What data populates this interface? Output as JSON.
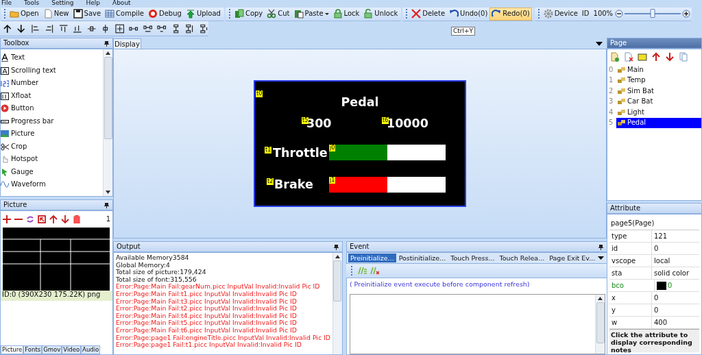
{
  "menu": [
    "File",
    "Tools",
    "Setting",
    "Help",
    "About"
  ],
  "toolbar": {
    "groups": [
      [
        {
          "label": "Open",
          "dropdown": false,
          "highlighted": false
        },
        {
          "label": "New",
          "dropdown": false,
          "highlighted": false
        },
        {
          "label": "Save",
          "dropdown": false,
          "highlighted": false
        },
        {
          "label": "Compile",
          "dropdown": false,
          "highlighted": false
        },
        {
          "label": "Debug",
          "dropdown": false,
          "highlighted": false
        },
        {
          "label": "Upload",
          "dropdown": false,
          "highlighted": false
        }
      ],
      [
        {
          "label": "Copy",
          "dropdown": false,
          "highlighted": false
        },
        {
          "label": "Cut",
          "dropdown": false,
          "highlighted": false
        },
        {
          "label": "Paste",
          "dropdown": true,
          "highlighted": false
        },
        {
          "label": "Lock",
          "dropdown": false,
          "highlighted": false
        },
        {
          "label": "Unlock",
          "dropdown": false,
          "highlighted": false
        }
      ],
      [
        {
          "label": "Delete",
          "dropdown": false,
          "highlighted": false
        },
        {
          "label": "Undo(0)",
          "dropdown": false,
          "highlighted": false
        },
        {
          "label": "Redo(0)",
          "dropdown": false,
          "highlighted": true
        }
      ],
      [
        {
          "label": "Device",
          "dropdown": false,
          "highlighted": false
        },
        {
          "label": "ID",
          "dropdown": false,
          "highlighted": false
        },
        {
          "label": "100%",
          "dropdown": false,
          "highlighted": false
        }
      ]
    ],
    "zoom_slider": {
      "level": 0.5
    },
    "tooltip": "Ctrl+Y"
  },
  "toolbox": {
    "title": "Toolbox",
    "items": [
      "Text",
      "Scrolling text",
      "Number",
      "Xfloat",
      "Button",
      "Progress bar",
      "Picture",
      "Crop",
      "Hotspot",
      "Gauge",
      "Waveform"
    ]
  },
  "picture": {
    "title": "Picture",
    "count": "1",
    "caption": "ID:0  (390X230 175.22K) png",
    "tabs": [
      {
        "label": "Picture",
        "selected": true
      },
      {
        "label": "Fonts",
        "selected": false
      },
      {
        "label": "Gmov",
        "selected": false
      },
      {
        "label": "Video",
        "selected": false
      },
      {
        "label": "Audio",
        "selected": false
      }
    ]
  },
  "display": {
    "title": "Display",
    "components": [
      {
        "tag": "t0",
        "kind": "text",
        "text": "Pedal"
      },
      {
        "tag": "t5",
        "kind": "text",
        "text": "300"
      },
      {
        "tag": "t6",
        "kind": "text",
        "text": "10000"
      },
      {
        "tag": "t1",
        "kind": "text",
        "text": "Throttle"
      },
      {
        "tag": "j0",
        "kind": "progress",
        "level": 0.5,
        "color": "#008000"
      },
      {
        "tag": "t2",
        "kind": "text",
        "text": "Brake"
      },
      {
        "tag": "j1",
        "kind": "progress",
        "level": 0.5,
        "color": "#ff0000"
      }
    ]
  },
  "output": {
    "title": "Output",
    "lines": [
      {
        "kind": "info",
        "text": "Available Memory3584"
      },
      {
        "kind": "info",
        "text": "Global Memory:4"
      },
      {
        "kind": "info",
        "text": "Total size of picture:179,424"
      },
      {
        "kind": "info",
        "text": "Total size of font:315,556"
      },
      {
        "kind": "error",
        "text": "Error:Page:Main Fail:gearNum.picc InputVal Invalid:Invalid Pic ID"
      },
      {
        "kind": "error",
        "text": "Error:Page:Main Fail:t1.picc InputVal Invalid:Invalid Pic ID"
      },
      {
        "kind": "error",
        "text": "Error:Page:Main Fail:t3.picc InputVal Invalid:Invalid Pic ID"
      },
      {
        "kind": "error",
        "text": "Error:Page:Main Fail:t2.picc InputVal Invalid:Invalid Pic ID"
      },
      {
        "kind": "error",
        "text": "Error:Page:Main Fail:t4.picc InputVal Invalid:Invalid Pic ID"
      },
      {
        "kind": "error",
        "text": "Error:Page:Main Fail:t5.picc InputVal Invalid:Invalid Pic ID"
      },
      {
        "kind": "error",
        "text": "Error:Page:Main Fail:t6.picc InputVal Invalid:Invalid Pic ID"
      },
      {
        "kind": "error",
        "text": "Error:Page:page1 Fail:engineTitle.picc InputVal Invalid:Invalid Pic ID"
      },
      {
        "kind": "error",
        "text": "Error:Page:page1 Fail:t1.picc InputVal Invalid:Invalid Pic ID"
      }
    ]
  },
  "event": {
    "title": "Event",
    "tabs": [
      {
        "label": "Preinitialize...",
        "selected": true
      },
      {
        "label": "Postinitialize...",
        "selected": false
      },
      {
        "label": "Touch Press...",
        "selected": false
      },
      {
        "label": "Touch Relea...",
        "selected": false
      },
      {
        "label": "Page Exit Ev...",
        "selected": false
      }
    ],
    "hint": "( Preinitialize event execute before component refresh)"
  },
  "page": {
    "title": "Page",
    "items": [
      {
        "index": "0",
        "name": "Main",
        "selected": false
      },
      {
        "index": "1",
        "name": "Temp",
        "selected": false
      },
      {
        "index": "2",
        "name": "Sim Bat",
        "selected": false
      },
      {
        "index": "3",
        "name": "Car Bat",
        "selected": false
      },
      {
        "index": "4",
        "name": "Light",
        "selected": false
      },
      {
        "index": "5",
        "name": "Pedal",
        "selected": true
      }
    ]
  },
  "attribute": {
    "title": "Attribute",
    "object": "page5(Page)",
    "rows": [
      {
        "kind": "plain",
        "name": "type",
        "value": "121"
      },
      {
        "kind": "plain",
        "name": "id",
        "value": "0"
      },
      {
        "kind": "plain",
        "name": "vscope",
        "value": "local"
      },
      {
        "kind": "plain",
        "name": "sta",
        "value": "solid color"
      },
      {
        "kind": "color",
        "name": "bco",
        "value": "0",
        "color": "#000000"
      },
      {
        "kind": "plain",
        "name": "x",
        "value": "0"
      },
      {
        "kind": "plain",
        "name": "y",
        "value": "0"
      },
      {
        "kind": "plain",
        "name": "w",
        "value": "400"
      }
    ],
    "note": "Click the attribute to display corresponding notes"
  }
}
